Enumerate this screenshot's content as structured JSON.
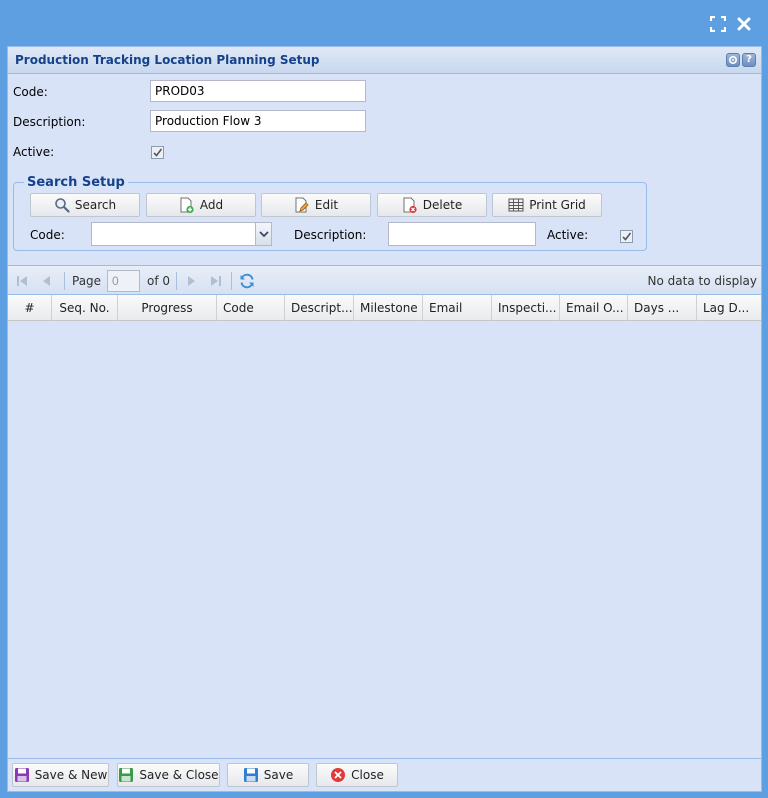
{
  "window": {
    "title": "Production Tracking Location Planning Setup"
  },
  "form": {
    "code_label": "Code:",
    "code_value": "PROD03",
    "description_label": "Description:",
    "description_value": "Production Flow 3",
    "active_label": "Active:",
    "active_checked": true
  },
  "search_setup": {
    "legend": "Search Setup",
    "buttons": {
      "search": "Search",
      "add": "Add",
      "edit": "Edit",
      "delete": "Delete",
      "print_grid": "Print Grid"
    },
    "code_label": "Code:",
    "code_value": "",
    "description_label": "Description:",
    "description_value": "",
    "active_label": "Active:",
    "active_checked": true
  },
  "pager": {
    "page_label": "Page",
    "page_value": "0",
    "of_label": "of 0",
    "status": "No data to display"
  },
  "grid": {
    "columns": [
      "#",
      "Seq. No.",
      "Progress",
      "Code",
      "Descript...",
      "Milestone",
      "Email",
      "Inspecti...",
      "Email O...",
      "Days ...",
      "Lag D..."
    ]
  },
  "footer": {
    "save_new": "Save & New",
    "save_close": "Save & Close",
    "save": "Save",
    "close": "Close"
  },
  "colors": {
    "accent": "#15428b",
    "frame": "#5d9fe0",
    "panel": "#d9e3f8"
  }
}
